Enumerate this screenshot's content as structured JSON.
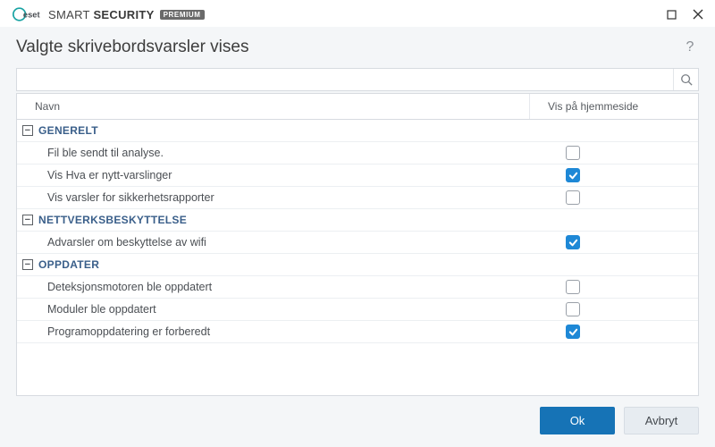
{
  "brand": {
    "logo_text": "eset",
    "name_light": "SMART ",
    "name_bold": "SECURITY",
    "badge": "PREMIUM"
  },
  "page": {
    "title": "Valgte skrivebordsvarsler vises"
  },
  "search": {
    "value": "",
    "placeholder": ""
  },
  "columns": {
    "name": "Navn",
    "show": "Vis på hjemmeside"
  },
  "groups": [
    {
      "label": "GENERELT",
      "items": [
        {
          "name": "Fil ble sendt til analyse.",
          "checked": false
        },
        {
          "name": "Vis Hva er nytt-varslinger",
          "checked": true
        },
        {
          "name": "Vis varsler for sikkerhetsrapporter",
          "checked": false
        }
      ]
    },
    {
      "label": "NETTVERKSBESKYTTELSE",
      "items": [
        {
          "name": "Advarsler om beskyttelse av wifi",
          "checked": true
        }
      ]
    },
    {
      "label": "OPPDATER",
      "items": [
        {
          "name": "Deteksjonsmotoren ble oppdatert",
          "checked": false
        },
        {
          "name": "Moduler ble oppdatert",
          "checked": false
        },
        {
          "name": "Programoppdatering er forberedt",
          "checked": true
        }
      ]
    }
  ],
  "buttons": {
    "ok": "Ok",
    "cancel": "Avbryt"
  }
}
